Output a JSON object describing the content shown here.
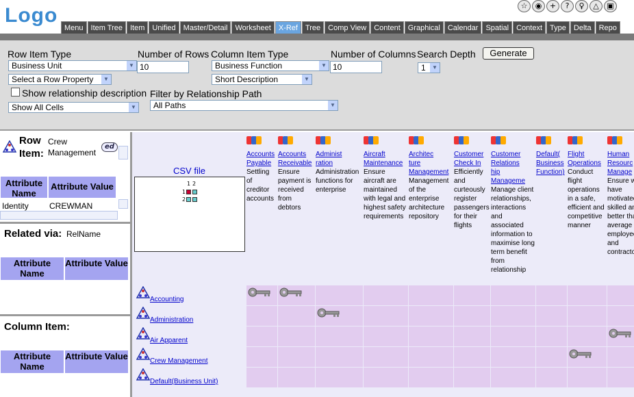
{
  "app": {
    "logo": "Logo"
  },
  "toolbar_icons": [
    {
      "icon": "star-icon",
      "glyph": "☆"
    },
    {
      "icon": "globe-icon",
      "glyph": "◉"
    },
    {
      "icon": "plus-icon",
      "glyph": "+"
    },
    {
      "icon": "help-icon",
      "glyph": "?"
    },
    {
      "icon": "pin-icon",
      "glyph": "♀"
    },
    {
      "icon": "warning-icon",
      "glyph": "△"
    },
    {
      "icon": "window-icon",
      "glyph": "▣"
    }
  ],
  "tabs": [
    "Menu",
    "Item Tree",
    "Item",
    "Unified",
    "Master/Detail",
    "Worksheet",
    "X-Ref",
    "Tree",
    "Comp View",
    "Content",
    "Graphical",
    "Calendar",
    "Spatial",
    "Context",
    "Type",
    "Delta",
    "Repo"
  ],
  "active_tab": "X-Ref",
  "controls": {
    "row_item_type_label": "Row Item Type",
    "row_item_type_value": "Business Unit",
    "row_property_value": "Select a Row Property",
    "show_rel_desc_label": "Show relationship description",
    "show_cells_value": "Show All Cells",
    "num_rows_label": "Number of Rows",
    "num_rows_value": "10",
    "filter_label": "Filter by Relationship Path",
    "filter_value": "All Paths",
    "col_item_type_label": "Column Item Type",
    "col_item_type_value": "Business Function",
    "col_property_value": "Short Description",
    "num_cols_label": "Number of Columns",
    "num_cols_value": "10",
    "search_depth_label": "Search Depth",
    "search_depth_value": "1",
    "generate_label": "Generate"
  },
  "row_item": {
    "title": "Row Item:",
    "name": "Crew Management",
    "edit_label": "ed",
    "attr_name_header": "Attribute Name",
    "attr_value_header": "Attribute Value",
    "rows": [
      {
        "name": "Identity",
        "value": "CREWMAN"
      }
    ]
  },
  "related_via": {
    "title": "Related via:",
    "value": "RelName",
    "attr_name_header": "Attribute Name",
    "attr_value_header": "Attribute Value"
  },
  "column_item": {
    "title": "Column Item:",
    "attr_name_header": "Attribute Name",
    "attr_value_header": "Attribute Value"
  },
  "grid": {
    "csv_label": "CSV file",
    "mini_cols": [
      "1",
      "2"
    ],
    "mini_rows": [
      "1",
      "2"
    ],
    "columns": [
      {
        "name": "Accounts Payable",
        "link_lines": [
          "Accounts",
          "Payable"
        ],
        "desc": "Settling of creditor accounts"
      },
      {
        "name": "Accounts Receivable",
        "link_lines": [
          "Accounts",
          "Receivable"
        ],
        "desc": "Ensure payment is received from debtors"
      },
      {
        "name": "Administration",
        "link_lines": [
          "Administ",
          "ration"
        ],
        "desc": "Administration functions for enterprise"
      },
      {
        "name": "Aircraft Maintenance",
        "link_lines": [
          "Aircraft",
          "Maintenance"
        ],
        "desc": "Ensure aircraft are maintained with legal and highest safety requirements"
      },
      {
        "name": "Architecture Management",
        "link_lines": [
          "Architec",
          "ture",
          "Management"
        ],
        "desc": "Management of the enterprise architecture repository"
      },
      {
        "name": "Customer Check In",
        "link_lines": [
          "Customer",
          "Check In"
        ],
        "desc": "Efficiently and curteously register passengers for their flights"
      },
      {
        "name": "Customer Relationship Management",
        "link_lines": [
          "Customer",
          "Relations",
          "hip",
          "Manageme"
        ],
        "desc": "Manage client relationships, interactions and associated information to maximise long term benefit from relationship"
      },
      {
        "name": "Default(Business Function)",
        "link_lines": [
          "Default(",
          "Business",
          "Function)"
        ],
        "desc": ""
      },
      {
        "name": "Flight Operations",
        "link_lines": [
          "Flight",
          "Operations"
        ],
        "desc": "Conduct flight operations in a safe, efficient and competitive manner"
      },
      {
        "name": "Human Resources Management",
        "link_lines": [
          "Human",
          "Resourc",
          "Manage"
        ],
        "desc": "Ensure we have motivated skilled and better than average employees and contractors"
      }
    ],
    "rows": [
      {
        "name": "Accounting",
        "keys": [
          0,
          1
        ]
      },
      {
        "name": "Administration",
        "keys": [
          2
        ]
      },
      {
        "name": "Air Apparent",
        "keys": [
          9
        ]
      },
      {
        "name": "Crew Management",
        "keys": [
          8
        ]
      },
      {
        "name": "Default(Business Unit)",
        "keys": []
      }
    ]
  }
}
